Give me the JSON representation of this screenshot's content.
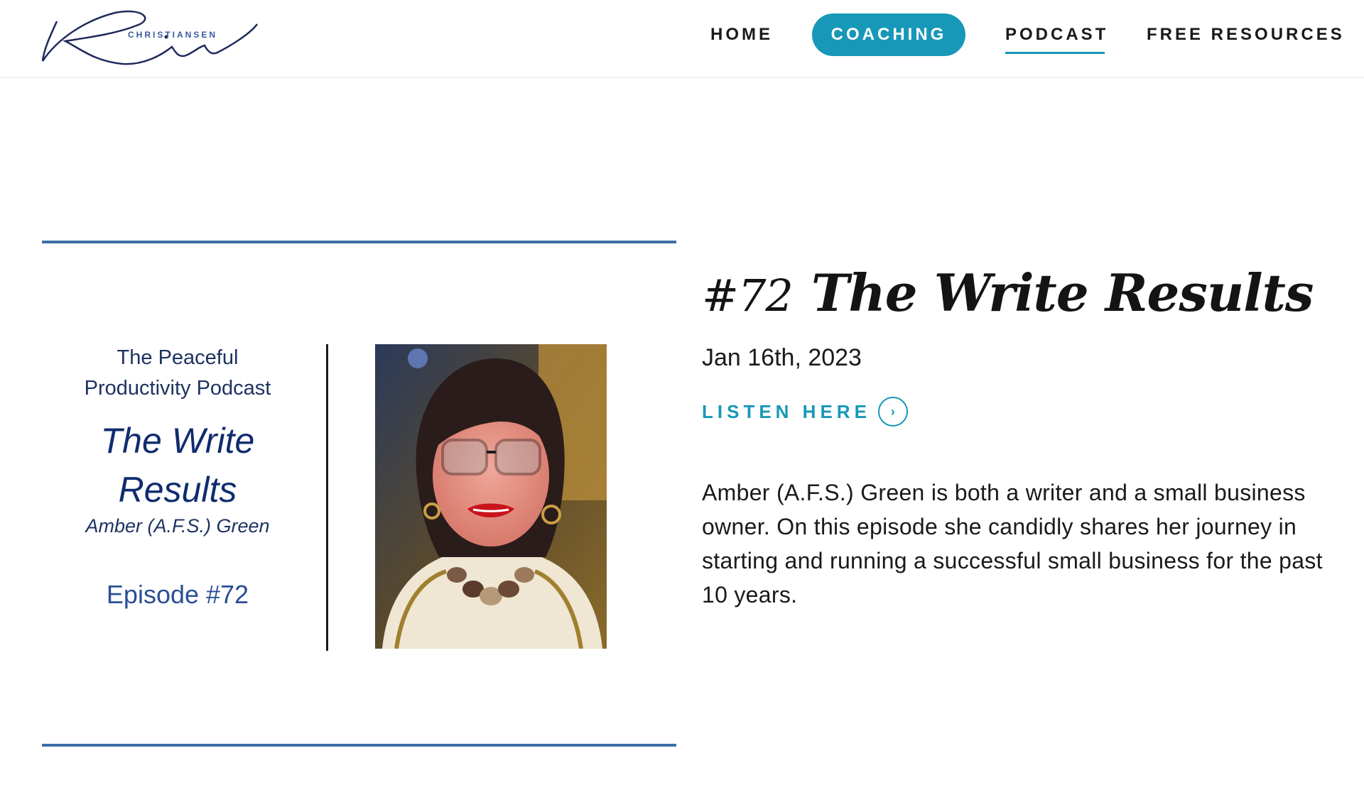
{
  "header": {
    "logo_script": "Kim",
    "logo_word": "CHRISTIANSEN",
    "nav": {
      "home": "HOME",
      "coaching": "COACHING",
      "podcast": "PODCAST",
      "free_resources": "FREE RESOURCES"
    }
  },
  "artwork": {
    "podcast_line1": "The Peaceful",
    "podcast_line2": "Productivity Podcast",
    "title_line1": "The Write",
    "title_line2": "Results",
    "guest": "Amber (A.F.S.) Green",
    "episode": "Episode #72"
  },
  "episode": {
    "number": "#72",
    "title": "The Write Results",
    "date": "Jan 16th, 2023",
    "listen_label": "LISTEN HERE",
    "description": "Amber  (A.F.S.) Green is both a writer and a small business owner.  On this episode she candidly shares her journey in starting and running a successful small business for the past 10 years."
  },
  "colors": {
    "accent": "#1798b8",
    "rule": "#3b6ea6",
    "artwork_text": "#0f2c6e"
  }
}
